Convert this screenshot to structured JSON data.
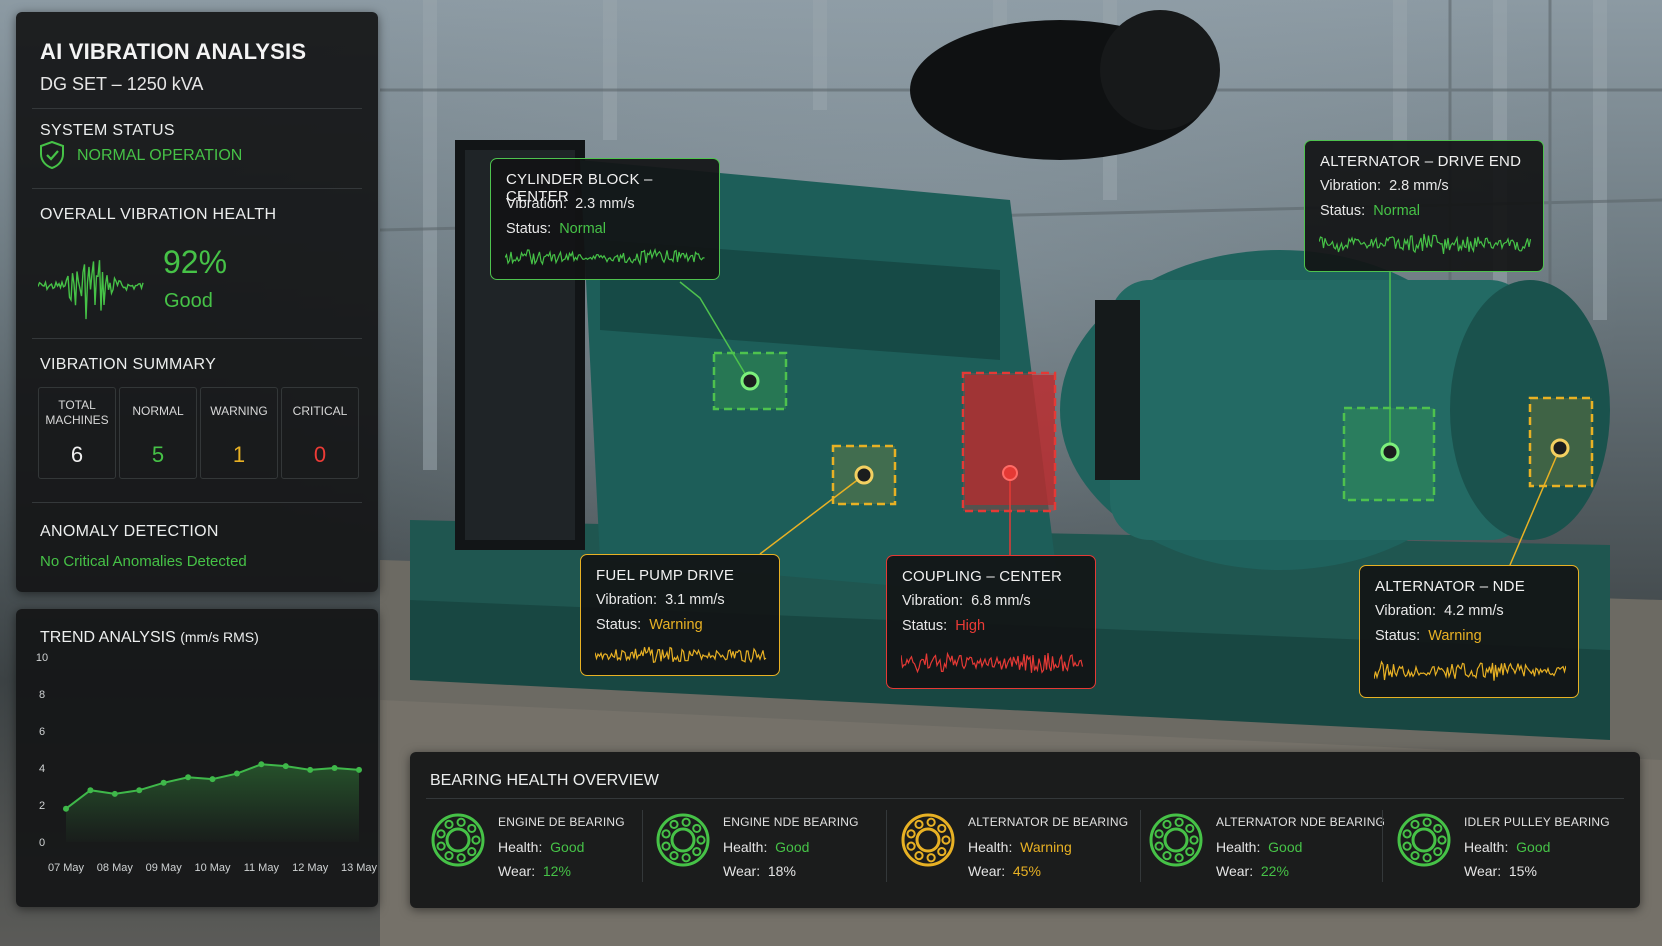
{
  "app": {
    "title": "AI VIBRATION ANALYSIS",
    "subtitle": "DG SET – 1250 kVA"
  },
  "system_status": {
    "label": "SYSTEM STATUS",
    "value": "NORMAL OPERATION",
    "icon": "shield-check-icon"
  },
  "overall_health": {
    "label": "OVERALL VIBRATION HEALTH",
    "percent": "92%",
    "word": "Good"
  },
  "vibration_summary": {
    "label": "VIBRATION SUMMARY",
    "cards": [
      {
        "label": "TOTAL MACHINES",
        "value": "6",
        "color": "#f0f0f0"
      },
      {
        "label": "NORMAL",
        "value": "5",
        "color": "#46c247"
      },
      {
        "label": "WARNING",
        "value": "1",
        "color": "#e8b124"
      },
      {
        "label": "CRITICAL",
        "value": "0",
        "color": "#ec3b36"
      }
    ]
  },
  "anomaly": {
    "label": "ANOMALY DETECTION",
    "value": "No Critical Anomalies Detected"
  },
  "chart_data": {
    "type": "line",
    "title": "TREND ANALYSIS",
    "unit": "(mm/s RMS)",
    "x": [
      "07 May",
      "08 May",
      "09 May",
      "10 May",
      "11 May",
      "12 May",
      "13 May"
    ],
    "y_ticks": [
      "10",
      "8",
      "6",
      "4",
      "2",
      "0"
    ],
    "ylim": [
      0,
      10
    ],
    "series": [
      {
        "x_index": [
          0,
          0.5,
          1,
          1.5,
          2,
          2.5,
          3,
          3.5,
          4,
          4.5,
          5,
          5.5,
          6
        ],
        "values": [
          1.8,
          2.8,
          2.6,
          2.8,
          3.2,
          3.5,
          3.4,
          3.7,
          4.2,
          4.1,
          3.9,
          4.0,
          3.9
        ]
      }
    ],
    "color": "#3fb84a",
    "grid": false
  },
  "callouts": [
    {
      "title": "CYLINDER BLOCK – CENTER",
      "vib_label": "Vibration:",
      "vib": "2.3 mm/s",
      "stat_label": "Status:",
      "status": "Normal",
      "level": "normal"
    },
    {
      "title": "ALTERNATOR – DRIVE END",
      "vib_label": "Vibration:",
      "vib": "2.8 mm/s",
      "stat_label": "Status:",
      "status": "Normal",
      "level": "normal"
    },
    {
      "title": "FUEL PUMP DRIVE",
      "vib_label": "Vibration:",
      "vib": "3.1 mm/s",
      "stat_label": "Status:",
      "status": "Warning",
      "level": "warning"
    },
    {
      "title": "COUPLING – CENTER",
      "vib_label": "Vibration:",
      "vib": "6.8 mm/s",
      "stat_label": "Status:",
      "status": "High",
      "level": "high"
    },
    {
      "title": "ALTERNATOR – NDE",
      "vib_label": "Vibration:",
      "vib": "4.2 mm/s",
      "stat_label": "Status:",
      "status": "Warning",
      "level": "warning"
    }
  ],
  "bearings": {
    "title": "BEARING HEALTH OVERVIEW",
    "items": [
      {
        "name": "ENGINE DE BEARING",
        "health_label": "Health:",
        "health": "Good",
        "wear_label": "Wear:",
        "wear": "12%",
        "level": "good"
      },
      {
        "name": "ENGINE NDE BEARING",
        "health_label": "Health:",
        "health": "Good",
        "wear_label": "Wear:",
        "wear": "18%",
        "level": "good"
      },
      {
        "name": "ALTERNATOR DE BEARING",
        "health_label": "Health:",
        "health": "Warning",
        "wear_label": "Wear:",
        "wear": "45%",
        "level": "warning"
      },
      {
        "name": "ALTERNATOR NDE BEARING",
        "health_label": "Health:",
        "health": "Good",
        "wear_label": "Wear:",
        "wear": "22%",
        "level": "good"
      },
      {
        "name": "IDLER PULLEY BEARING",
        "health_label": "Health:",
        "health": "Good",
        "wear_label": "Wear:",
        "wear": "15%",
        "level": "good"
      }
    ]
  },
  "colors": {
    "normal": "#46c247",
    "warning": "#e8b124",
    "critical": "#ec3b36",
    "panel": "#141617"
  }
}
